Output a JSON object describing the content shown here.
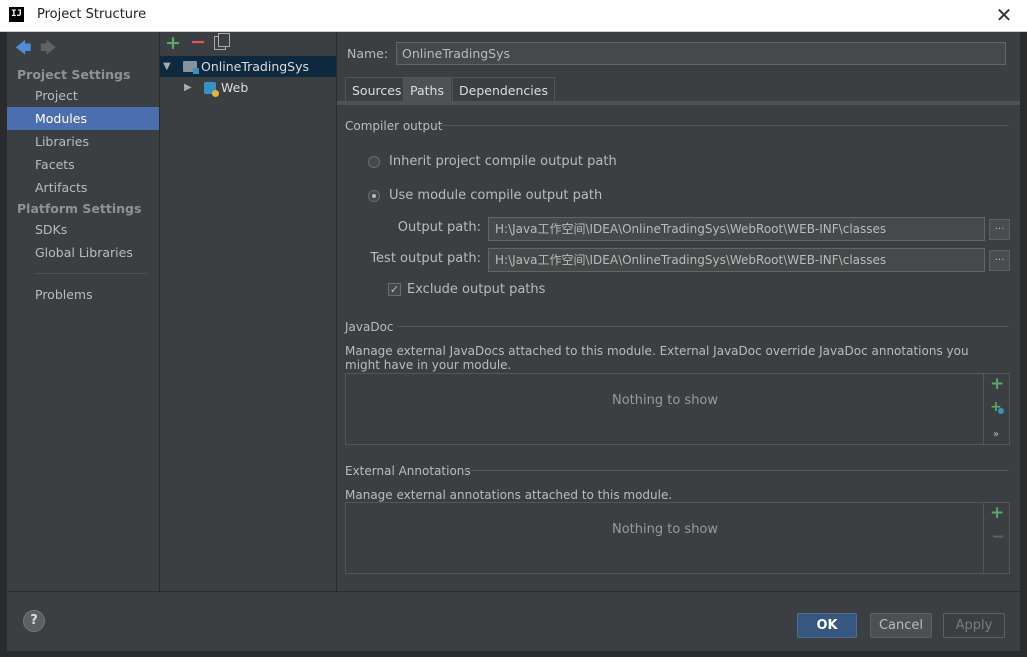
{
  "window": {
    "title": "Project Structure",
    "logo_text": "IJ"
  },
  "sidebar": {
    "sections": [
      {
        "title": "Project Settings",
        "items": [
          "Project",
          "Modules",
          "Libraries",
          "Facets",
          "Artifacts"
        ]
      },
      {
        "title": "Platform Settings",
        "items": [
          "SDKs",
          "Global Libraries"
        ]
      }
    ],
    "extra_item": "Problems",
    "selected": "Modules"
  },
  "tree": {
    "root": "OnlineTradingSys",
    "child": "Web"
  },
  "content": {
    "name_label": "Name:",
    "name_value": "OnlineTradingSys",
    "tabs": [
      "Sources",
      "Paths",
      "Dependencies"
    ],
    "active_tab": "Paths",
    "compiler_output": {
      "title": "Compiler output",
      "option_inherit": "Inherit project compile output path",
      "option_module": "Use module compile output path",
      "output_label": "Output path:",
      "output_value": "H:\\Java工作空间\\IDEA\\OnlineTradingSys\\WebRoot\\WEB-INF\\classes",
      "test_label": "Test output path:",
      "test_value": "H:\\Java工作空间\\IDEA\\OnlineTradingSys\\WebRoot\\WEB-INF\\classes",
      "exclude_label": "Exclude output paths",
      "browse": "..."
    },
    "javadoc": {
      "title": "JavaDoc",
      "description": "Manage external JavaDocs attached to this module. External JavaDoc override JavaDoc annotations you might have in your module.",
      "empty": "Nothing to show",
      "more": "»"
    },
    "annotations": {
      "title": "External Annotations",
      "description": "Manage external annotations attached to this module.",
      "empty": "Nothing to show"
    }
  },
  "footer": {
    "help": "?",
    "ok": "OK",
    "cancel": "Cancel",
    "apply": "Apply"
  },
  "icons": {
    "back": "back-arrow-icon",
    "forward": "forward-arrow-icon",
    "add": "plus-icon",
    "remove": "minus-icon",
    "copy": "copy-icon"
  },
  "colors": {
    "selection": "#4b6eaf",
    "accent_green": "#59a869",
    "accent_red": "#e05555",
    "ok_button": "#365880"
  }
}
